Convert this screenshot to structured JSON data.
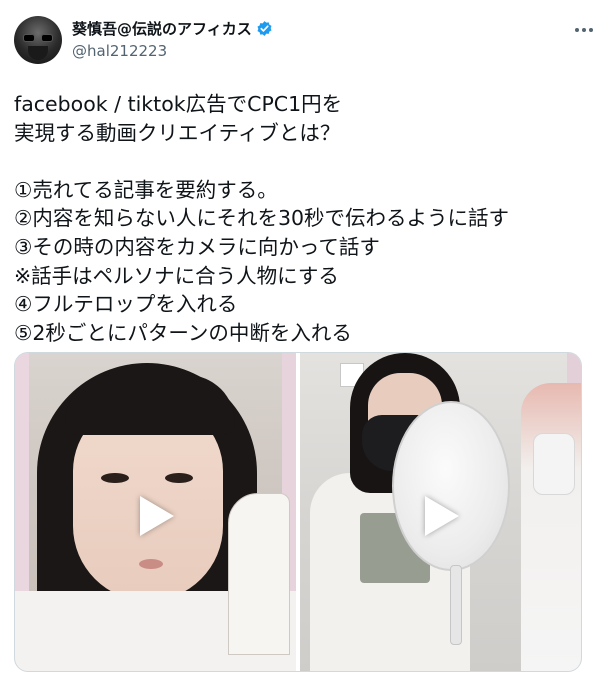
{
  "author": {
    "display_name": "葵慎吾@伝説のアフィカス",
    "handle": "@hal212223",
    "verified_icon": "verified-badge-icon",
    "avatar_icon": "avatar"
  },
  "tweet": {
    "lines": [
      "facebook / tiktok広告でCPC1円を",
      "実現する動画クリエイティブとは？",
      "",
      "①売れてる記事を要約する。",
      "②内容を知らない人にそれを30秒で伝わるように話す",
      "③その時の内容をカメラに向かって話す",
      "※話手はペルソナに合う人物にする",
      "④フルテロップを入れる",
      "⑤2秒ごとにパターンの中断を入れる"
    ]
  },
  "media": {
    "videos": [
      {
        "label": "video-1",
        "play_icon": "play-icon"
      },
      {
        "label": "video-2",
        "play_icon": "play-icon"
      }
    ]
  },
  "colors": {
    "text": "#0f1419",
    "secondary": "#536471",
    "verified": "#1d9bf0",
    "border": "#cfd9de"
  }
}
